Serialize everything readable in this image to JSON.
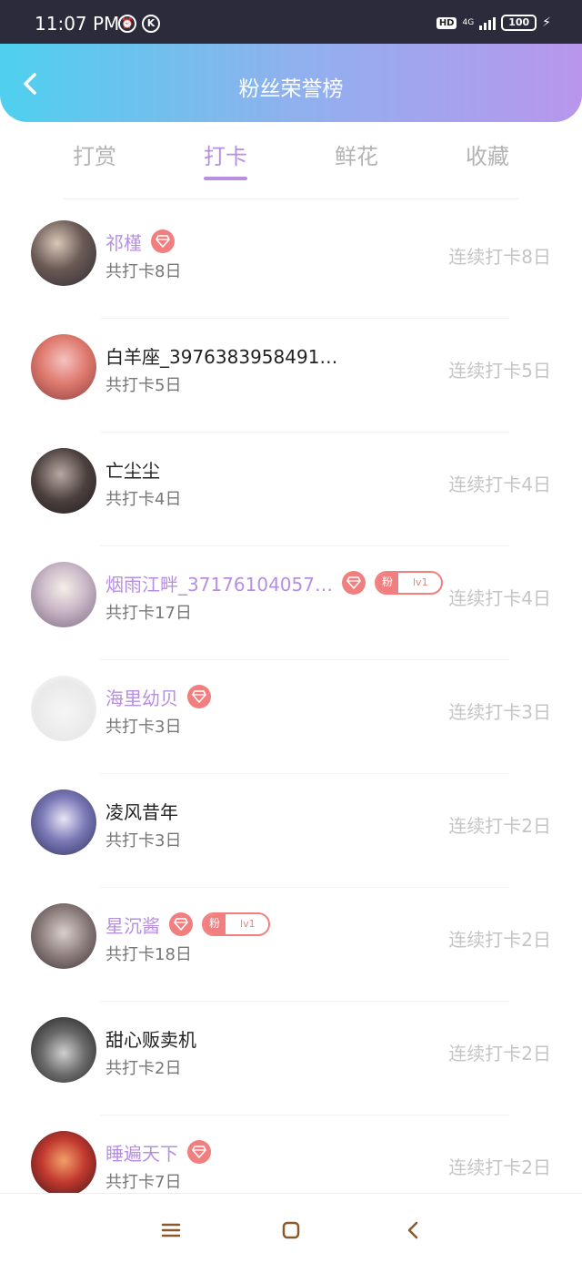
{
  "status_bar": {
    "time": "11:07 PM",
    "left_icons": [
      "alarm-icon",
      "k-icon"
    ],
    "hd": "HD",
    "network": "4G",
    "battery": "100"
  },
  "header": {
    "title": "粉丝荣誉榜",
    "back_icon": "chevron-left-icon",
    "gradient": [
      "#4fd0ee",
      "#8fb1ee",
      "#b896ec"
    ]
  },
  "tabs": [
    {
      "label": "打赏",
      "active": false
    },
    {
      "label": "打卡",
      "active": true
    },
    {
      "label": "鲜花",
      "active": false
    },
    {
      "label": "收藏",
      "active": false
    }
  ],
  "accent_color": "#b78fe1",
  "badge_color": "#f27f7f",
  "fans": [
    {
      "name": "祁槿",
      "vip": true,
      "gem": true,
      "fan_badge": false,
      "total": "共打卡8日",
      "streak": "连续打卡8日"
    },
    {
      "name": "白羊座_3976383958491…",
      "vip": false,
      "gem": false,
      "fan_badge": false,
      "total": "共打卡5日",
      "streak": "连续打卡5日"
    },
    {
      "name": "亡尘尘",
      "vip": false,
      "gem": false,
      "fan_badge": false,
      "total": "共打卡4日",
      "streak": "连续打卡4日"
    },
    {
      "name": "烟雨江畔_37176104057…",
      "vip": true,
      "gem": true,
      "fan_badge": true,
      "fan_label": "粉",
      "fan_level": "lv1",
      "total": "共打卡17日",
      "streak": "连续打卡4日"
    },
    {
      "name": "海里幼贝",
      "vip": true,
      "gem": true,
      "fan_badge": false,
      "total": "共打卡3日",
      "streak": "连续打卡3日"
    },
    {
      "name": "凌风昔年",
      "vip": false,
      "gem": false,
      "fan_badge": false,
      "total": "共打卡3日",
      "streak": "连续打卡2日"
    },
    {
      "name": "星沉酱",
      "vip": true,
      "gem": true,
      "fan_badge": true,
      "fan_label": "粉",
      "fan_level": "lv1",
      "total": "共打卡18日",
      "streak": "连续打卡2日"
    },
    {
      "name": "甜心贩卖机",
      "vip": false,
      "gem": false,
      "fan_badge": false,
      "total": "共打卡2日",
      "streak": "连续打卡2日"
    },
    {
      "name": "睡遍天下",
      "vip": true,
      "gem": true,
      "fan_badge": false,
      "total": "共打卡7日",
      "streak": "连续打卡2日"
    }
  ],
  "nav_bar": {
    "icons": [
      "menu-icon",
      "home-square-icon",
      "back-arrow-icon"
    ]
  }
}
